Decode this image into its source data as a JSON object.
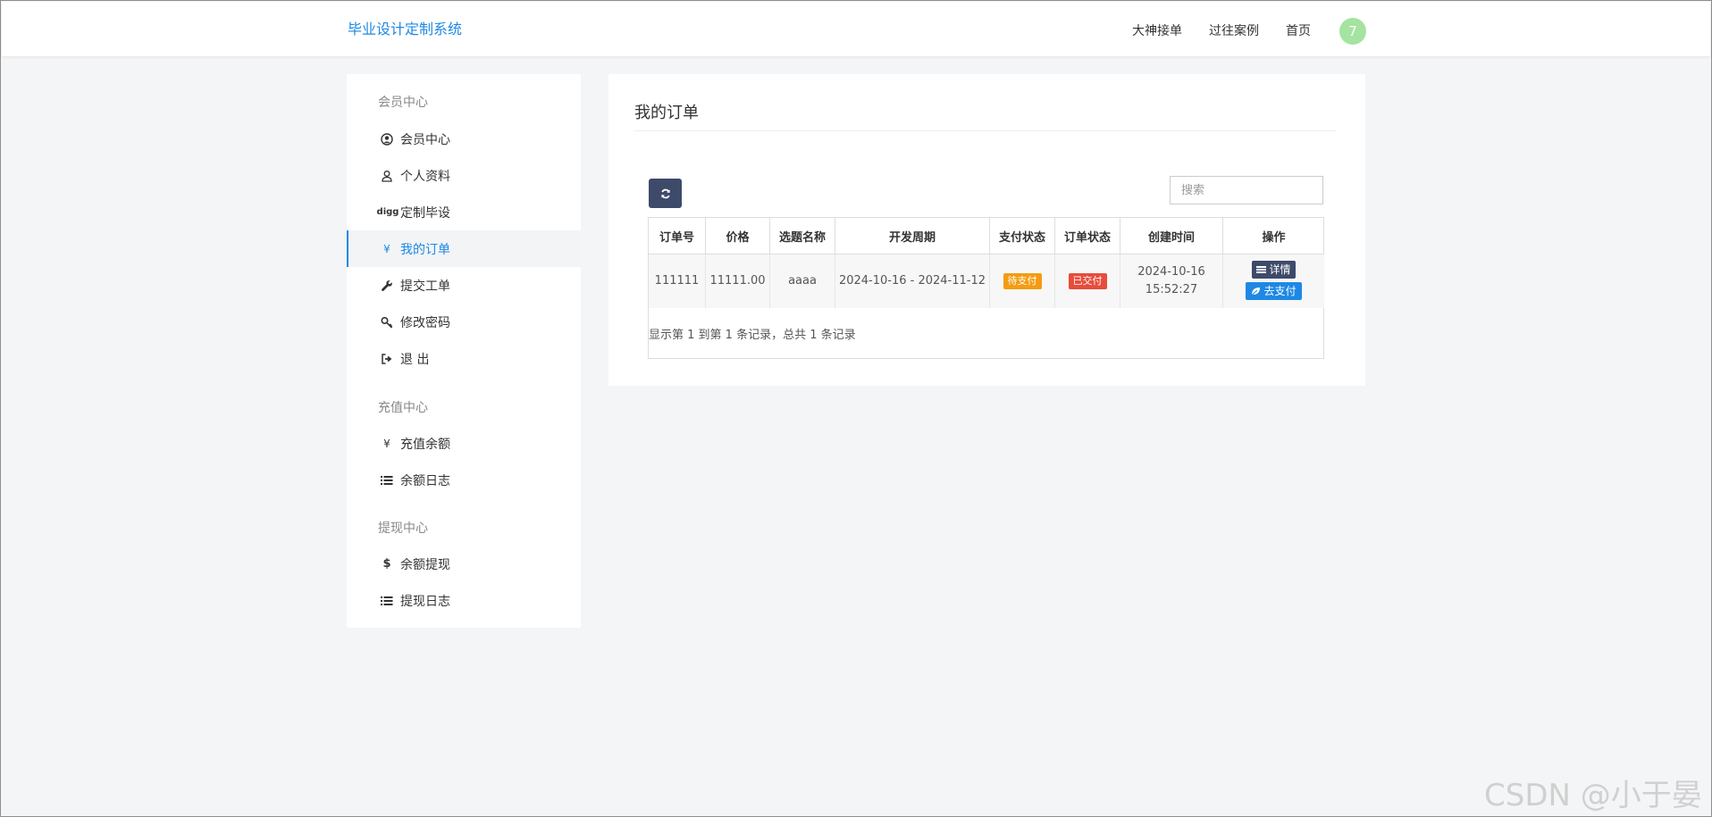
{
  "header": {
    "brand": "毕业设计定制系统",
    "nav": [
      "大神接单",
      "过往案例",
      "首页"
    ],
    "avatar_text": "7"
  },
  "sidebar": {
    "groups": [
      {
        "title": "会员中心",
        "items": [
          {
            "label": "会员中心",
            "icon": "user-circle-icon"
          },
          {
            "label": "个人资料",
            "icon": "user-icon"
          },
          {
            "label": "定制毕设",
            "icon": "digg-icon",
            "icon_text": "digg"
          },
          {
            "label": "我的订单",
            "icon": "yen-icon",
            "icon_text": "¥",
            "active": true
          },
          {
            "label": "提交工单",
            "icon": "wrench-icon"
          },
          {
            "label": "修改密码",
            "icon": "key-icon"
          },
          {
            "label": "退 出",
            "icon": "sign-out-icon"
          }
        ]
      },
      {
        "title": "充值中心",
        "items": [
          {
            "label": "充值余额",
            "icon": "yen-icon",
            "icon_text": "¥"
          },
          {
            "label": "余额日志",
            "icon": "list-icon"
          }
        ]
      },
      {
        "title": "提现中心",
        "items": [
          {
            "label": "余额提现",
            "icon": "dollar-icon",
            "icon_text": "$"
          },
          {
            "label": "提现日志",
            "icon": "list-icon"
          }
        ]
      }
    ],
    "accent": "#1e88e5"
  },
  "main": {
    "title": "我的订单",
    "search_placeholder": "搜索",
    "table": {
      "columns": [
        "订单号",
        "价格",
        "选题名称",
        "开发周期",
        "支付状态",
        "订单状态",
        "创建时间",
        "操作"
      ],
      "rows": [
        {
          "order_no": "111111",
          "price": "11111.00",
          "topic": "aaaa",
          "period": "2024-10-16 - 2024-11-12",
          "pay_status": "待支付",
          "order_status": "已交付",
          "created_date": "2024-10-16",
          "created_time": "15:52:27",
          "actions": {
            "detail": "详情",
            "pay": "去支付"
          }
        }
      ]
    },
    "pager_info": "显示第 1 到第 1 条记录，总共 1 条记录"
  },
  "watermark": "CSDN @小于晏",
  "colors": {
    "brand": "#1e88e5",
    "dark_button": "#3d4a6a",
    "badge_pending": "#f39c12",
    "badge_done": "#e74c3c",
    "avatar_bg": "#a5e3a1"
  }
}
